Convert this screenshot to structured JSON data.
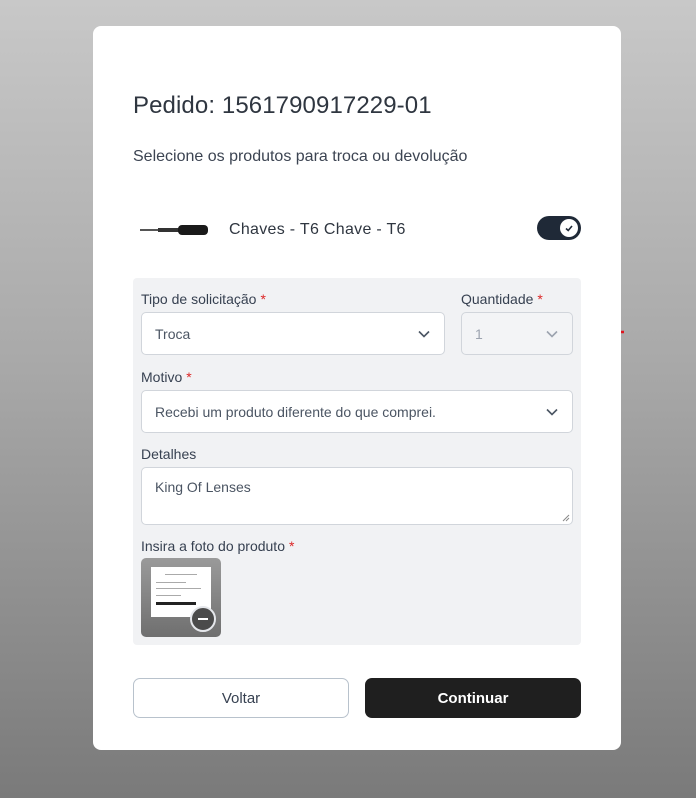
{
  "order": {
    "title": "Pedido: 1561790917229-01",
    "subtitle": "Selecione os produtos para troca ou devolução"
  },
  "product": {
    "name": "Chaves - T6 Chave - T6",
    "image_icon": "screwdriver-image",
    "selected": true
  },
  "form": {
    "request_type": {
      "label": "Tipo de solicitação",
      "required_mark": "*",
      "value": "Troca"
    },
    "quantity": {
      "label": "Quantidade",
      "required_mark": "*",
      "value": "1",
      "disabled": true
    },
    "reason": {
      "label": "Motivo",
      "required_mark": "*",
      "value": "Recebi um produto diferente do que comprei."
    },
    "details": {
      "label": "Detalhes",
      "value": "King Of Lenses"
    },
    "photo": {
      "label": "Insira a foto do produto",
      "required_mark": "*"
    }
  },
  "buttons": {
    "back": "Voltar",
    "continue": "Continuar"
  },
  "colors": {
    "annotation_arrow": "#e0141e",
    "primary_button": "#1f1f1f",
    "required": "#dc2626"
  }
}
